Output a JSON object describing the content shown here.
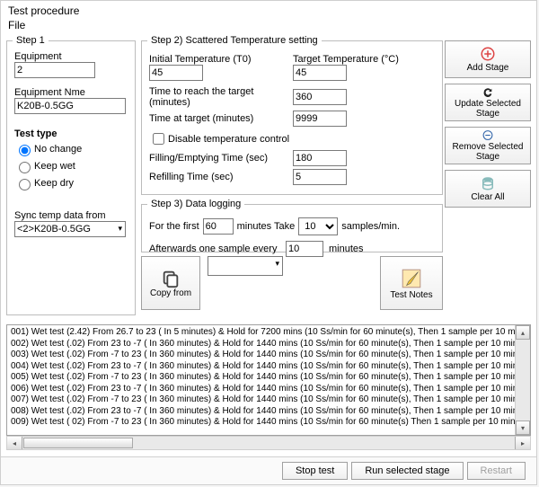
{
  "window": {
    "title": "Test procedure"
  },
  "menu": {
    "file": "File"
  },
  "step1": {
    "legend": "Step 1",
    "equipment_label": "Equipment",
    "equipment_value": "2",
    "equipment_name_label": "Equipment Nme",
    "equipment_name_value": "K20B-0.5GG",
    "test_type_label": "Test type",
    "opt_nochange": "No change",
    "opt_keepwet": "Keep wet",
    "opt_keepdry": "Keep dry",
    "sync_label": "Sync temp data from",
    "sync_value": "<2>K20B-0.5GG"
  },
  "step2": {
    "legend": "Step 2) Scattered Temperature setting",
    "initial_temp_label": "Initial Temperature (T0)",
    "initial_temp_value": "45",
    "target_temp_label": "Target Temperature (°C)",
    "target_temp_value": "45",
    "time_reach_label": "Time to reach the target (minutes)",
    "time_reach_value": "360",
    "time_at_target_label": "Time at target (minutes)",
    "time_at_target_value": "9999",
    "disable_label": "Disable temperature control",
    "fill_label": "Filling/Emptying Time (sec)",
    "fill_value": "180",
    "refill_label": "Refilling Time (sec)",
    "refill_value": "5"
  },
  "step3": {
    "legend": "Step 3) Data logging",
    "first_pre": "For the first",
    "first_min_value": "60",
    "first_mid": "minutes  Take",
    "take_value": "10",
    "first_post": "samples/min.",
    "after_pre": "Afterwards one sample every",
    "after_value": "10",
    "after_post": "minutes"
  },
  "side": {
    "add": "Add Stage",
    "update": "Update Selected Stage",
    "remove": "Remove Selected Stage",
    "clear": "Clear All"
  },
  "mid": {
    "copy": "Copy from",
    "notes": "Test Notes"
  },
  "log": {
    "lines": [
      "001) Wet test (2.42)  From  26.7 to  23  ( In 5 minutes)  & Hold for 7200 mins  (10 Ss/min for 60 minute(s),  Then 1 sample per 10 mi",
      "002) Wet test (.02)  From  23 to -7  ( In 360 minutes)  & Hold for 1440 mins  (10 Ss/min for 60 minute(s),  Then 1 sample per 10 min",
      "003) Wet test (.02)  From -7 to  23  ( In 360 minutes)  & Hold for 1440 mins  (10 Ss/min for 60 minute(s),  Then 1 sample per 10 min",
      "004) Wet test (.02)  From  23 to -7  ( In 360 minutes)  & Hold for 1440 mins  (10 Ss/min for 60 minute(s),  Then 1 sample per 10 min",
      "005) Wet test (.02)  From -7 to  23  ( In 360 minutes)  & Hold for 1440 mins  (10 Ss/min for 60 minute(s),  Then 1 sample per 10 min",
      "006) Wet test (.02)  From  23 to -7  ( In 360 minutes)  & Hold for 1440 mins  (10 Ss/min for 60 minute(s),  Then 1 sample per 10 min",
      "007) Wet test (.02)  From -7 to  23  ( In 360 minutes)  & Hold for 1440 mins  (10 Ss/min for 60 minute(s),  Then 1 sample per 10 min",
      "008) Wet test (.02)  From  23 to -7  ( In 360 minutes)  & Hold for 1440 mins  (10 Ss/min for 60 minute(s),  Then 1 sample per 10 min",
      "009) Wet test ( 02)  From  -7 to  23  ( In 360 minutes)  & Hold for 1440 mins  (10 Ss/min for 60 minute(s)   Then 1 sample per 10 min"
    ]
  },
  "bottom": {
    "stop": "Stop test",
    "run": "Run selected stage",
    "restart": "Restart"
  }
}
